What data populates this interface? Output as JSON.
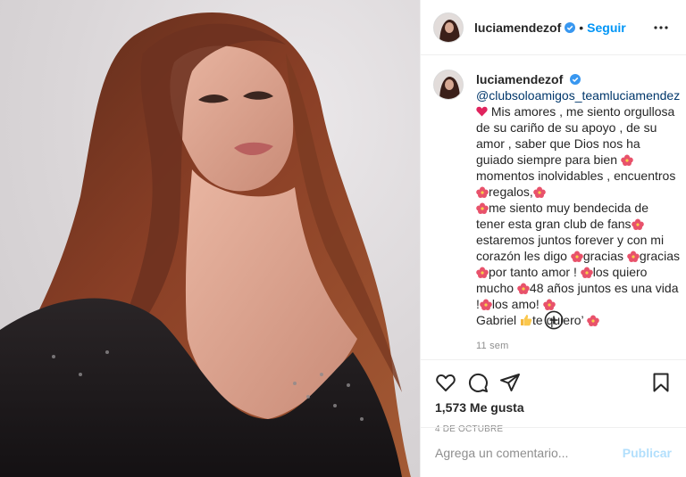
{
  "colors": {
    "accent": "#0095f6",
    "link": "#00376b",
    "muted": "#8e8e8e",
    "publish_disabled": "#b2dffc",
    "verified": "#3897f0",
    "hibiscus": "#e8526b"
  },
  "header": {
    "username": "luciamendezof",
    "dot": "•",
    "follow_label": "Seguir",
    "more_icon": "more-horizontal-icon",
    "verified_icon": "verified-badge-icon"
  },
  "caption": {
    "username": "luciamendezof",
    "mention": "@clubsoloamigos_teamluciamendez",
    "segments": [
      "Mis amores , me siento orgullosa de su cariño de su apoyo , de su amor , saber que Dios nos ha guiado siempre para bien ",
      "momentos inolvidables , encuentros ",
      "regalos,",
      "me siento muy bendecida de tener esta gran club de fans",
      "estaremos juntos forever y con mi corazón les digo ",
      "gracias ",
      "gracias ",
      "por tanto amor ! ",
      "los quiero mucho ",
      "48 años juntos es una vida !",
      "los amo! ",
      "Gabriel ",
      "te quiero’ "
    ],
    "time_ago": "11 sem"
  },
  "load_more_icon": "plus-circle-icon",
  "actions": {
    "like_icon": "heart-outline-icon",
    "comment_icon": "comment-icon",
    "share_icon": "paper-plane-icon",
    "save_icon": "bookmark-icon",
    "likes": "1,573 Me gusta",
    "date": "4 DE OCTUBRE"
  },
  "comment_box": {
    "placeholder": "Agrega un comentario...",
    "publish_label": "Publicar"
  }
}
